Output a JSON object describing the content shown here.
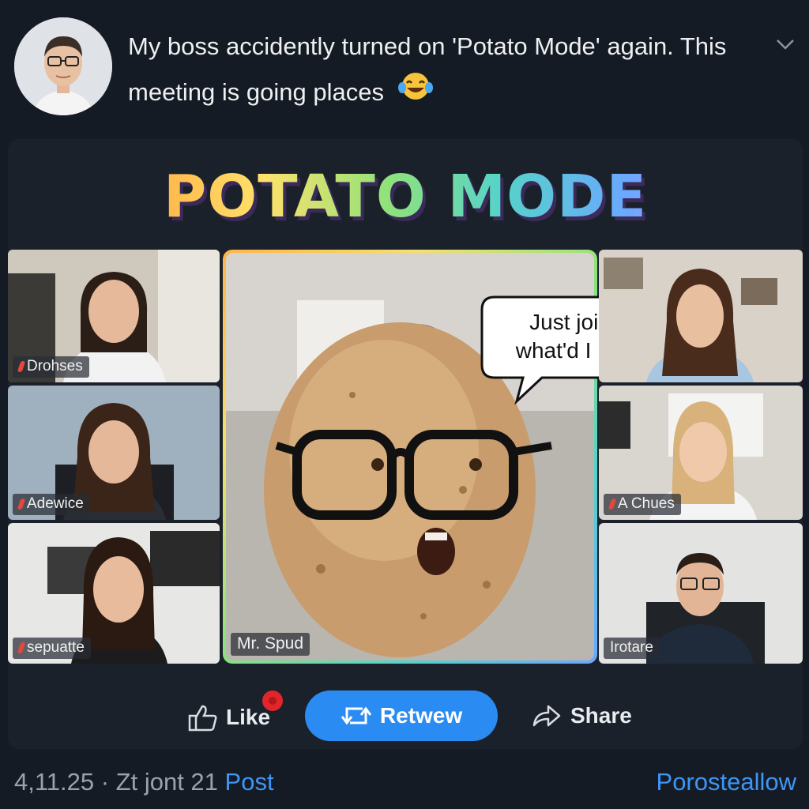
{
  "post": {
    "text_line1": "My boss accidently turned on 'Potato Mode' again. This",
    "text_line2": "meeting is going places",
    "emoji": "laughing-tears-emoji"
  },
  "media": {
    "banner": "POTATO MODE",
    "bubble_line1": "Just joined,",
    "bubble_line2": "what'd I miss?",
    "participants": [
      {
        "name": "Drohses",
        "muted": true
      },
      {
        "name": "Adewice",
        "muted": true
      },
      {
        "name": "sepuatte",
        "muted": true
      },
      {
        "name": "Mr. Spud",
        "muted": false
      },
      {
        "name": "",
        "muted": false
      },
      {
        "name": "A Chues",
        "muted": true
      },
      {
        "name": "Irotare",
        "muted": false
      }
    ]
  },
  "actions": {
    "like_label": "Like",
    "retweet_label": "Retwew",
    "share_label": "Share"
  },
  "footer": {
    "meta": "4,11.25 · Zt jont 21",
    "post_link": "Post",
    "right_link": "Porosteallow"
  },
  "colors": {
    "background": "#151b24",
    "accent": "#2a8bf2",
    "link": "#3d96f5",
    "notification": "#e1252b"
  }
}
